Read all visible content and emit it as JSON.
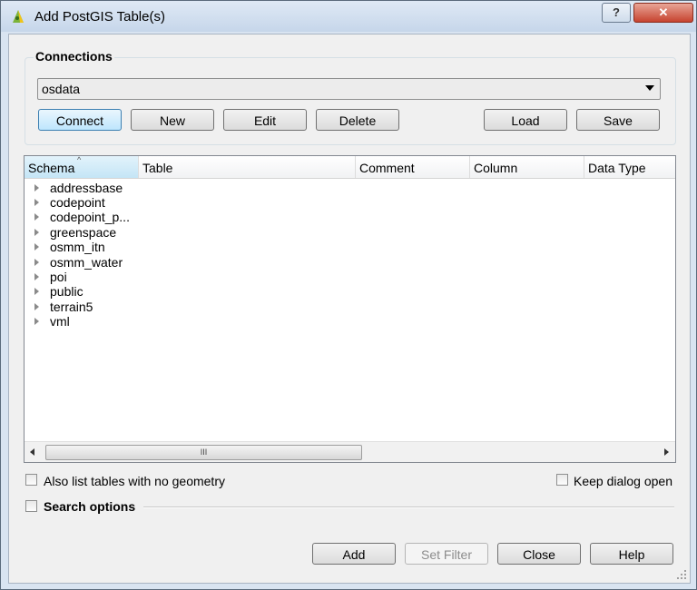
{
  "window": {
    "title": "Add PostGIS Table(s)",
    "help_symbol": "?",
    "close_symbol": "✕"
  },
  "connections": {
    "group_label": "Connections",
    "selected": "osdata",
    "buttons": {
      "connect": "Connect",
      "new": "New",
      "edit": "Edit",
      "delete": "Delete",
      "load": "Load",
      "save": "Save"
    }
  },
  "tree": {
    "columns": [
      "Schema",
      "Table",
      "Comment",
      "Column",
      "Data Type"
    ],
    "sort_indicator": "^",
    "rows": [
      "addressbase",
      "codepoint",
      "codepoint_p...",
      "greenspace",
      "osmm_itn",
      "osmm_water",
      "poi",
      "public",
      "terrain5",
      "vml"
    ],
    "scroll_grip": "III"
  },
  "options": {
    "list_no_geometry": "Also list tables with no geometry",
    "keep_dialog_open": "Keep dialog open",
    "search_options": "Search options"
  },
  "footer": {
    "add": "Add",
    "set_filter": "Set Filter",
    "close": "Close",
    "help": "Help"
  },
  "colors": {
    "titlebar": "#c6d6ea",
    "close_button": "#c7432f",
    "client_bg": "#f0f0f0",
    "focus_button": "#bee6fd"
  }
}
